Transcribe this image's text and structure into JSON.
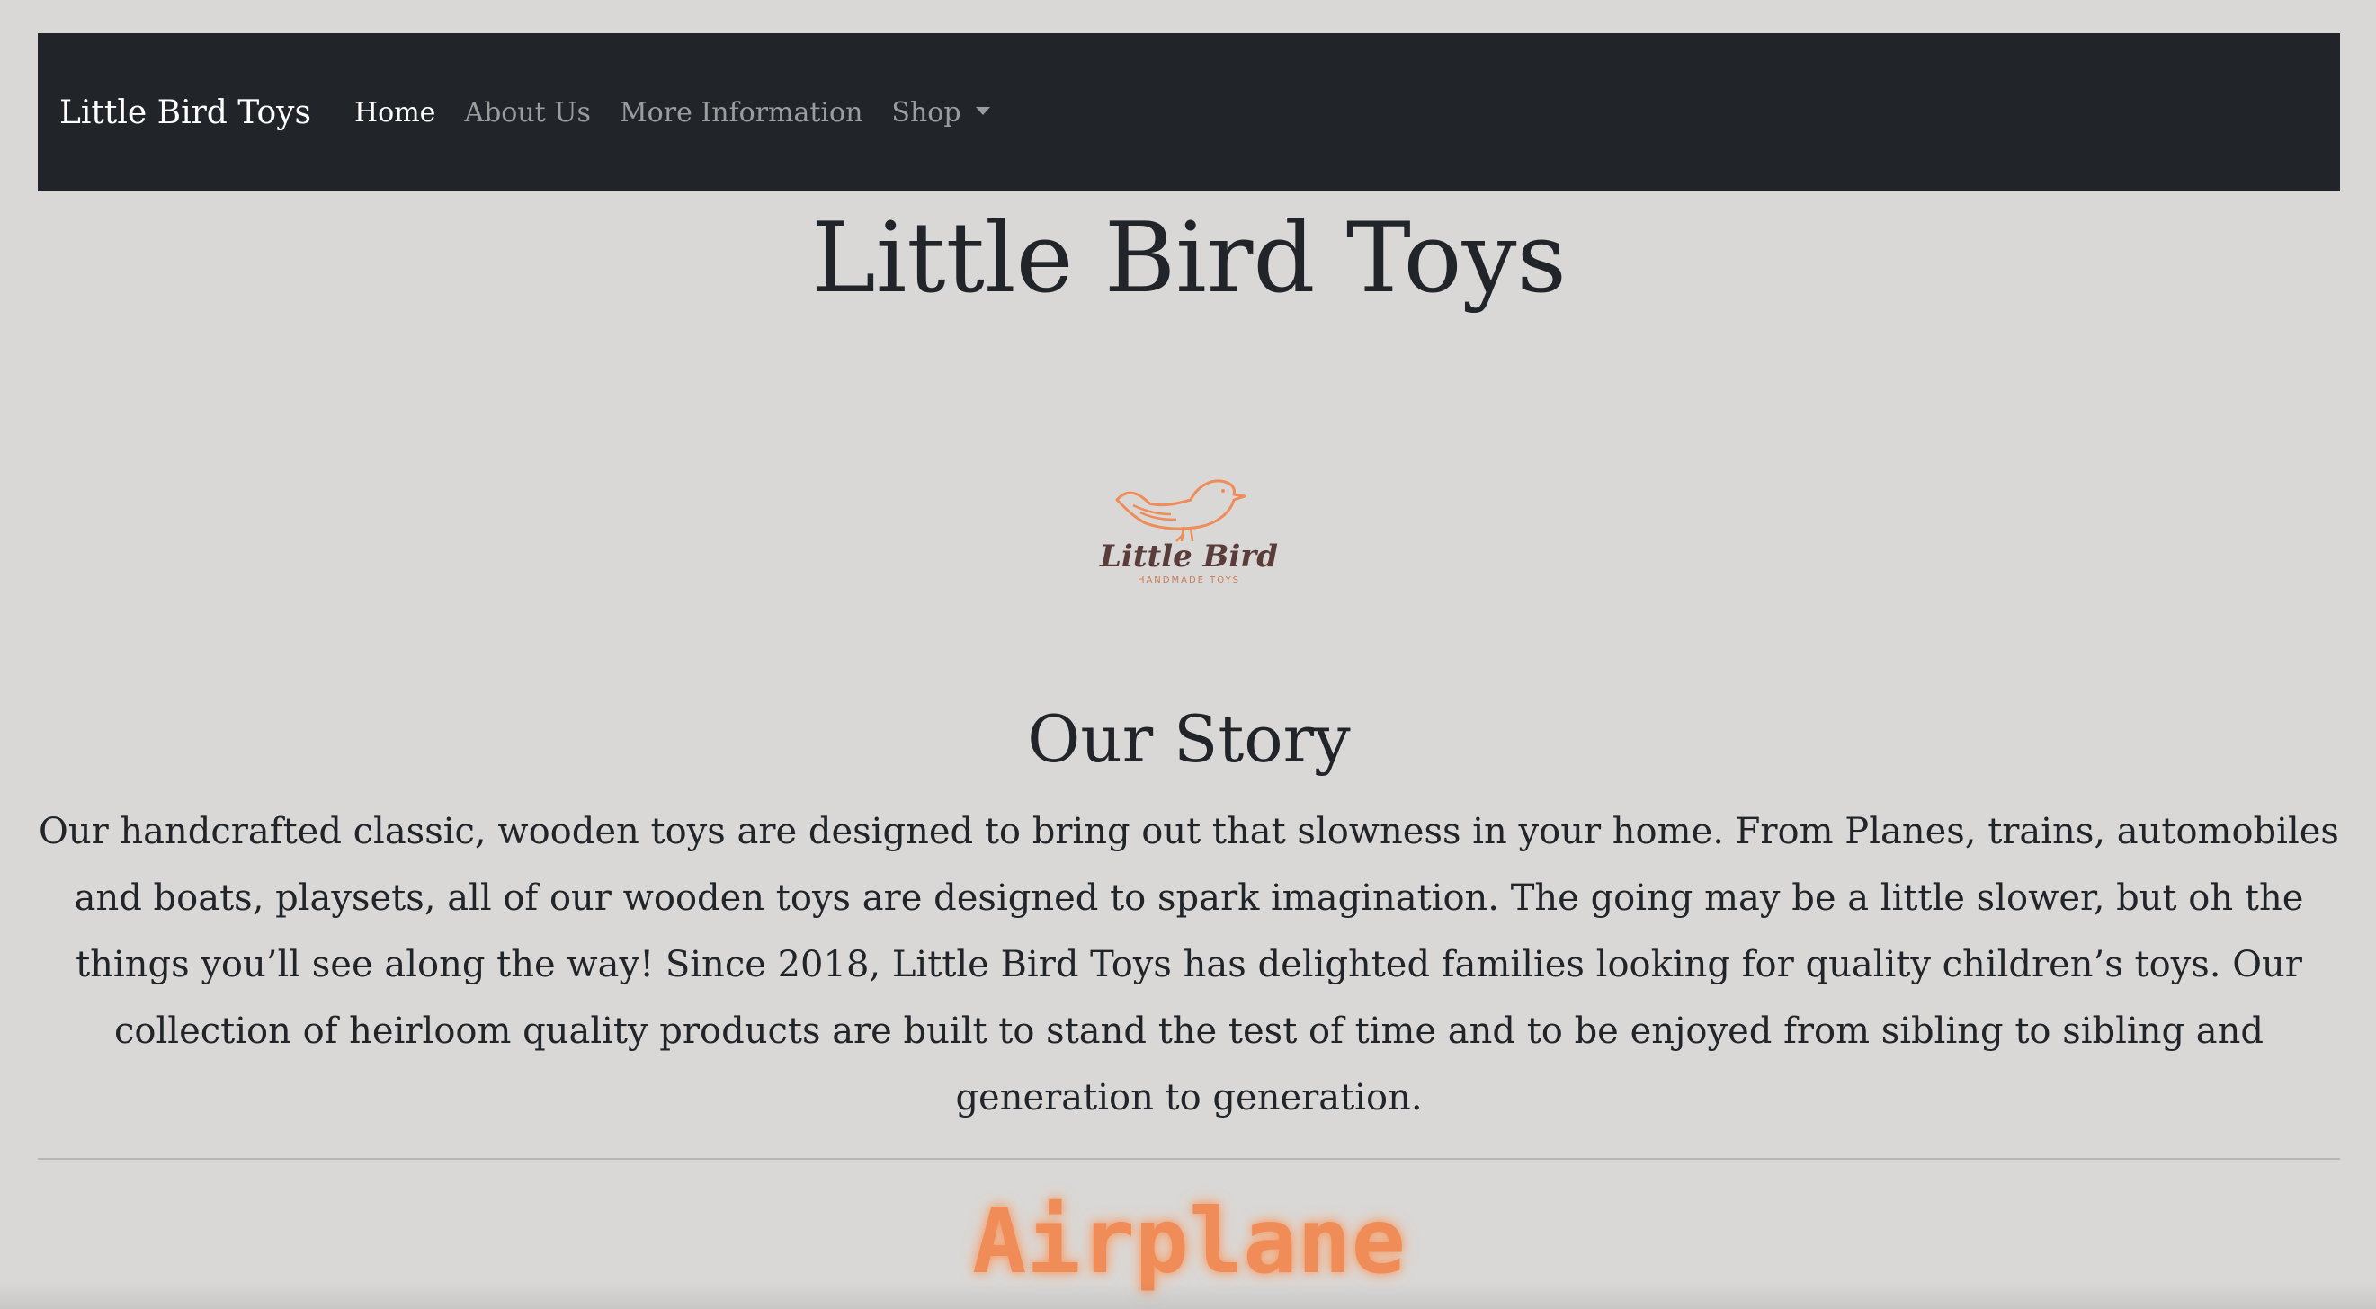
{
  "navbar": {
    "brand": "Little Bird Toys",
    "links": [
      {
        "label": "Home",
        "active": true
      },
      {
        "label": "About Us",
        "active": false
      },
      {
        "label": "More Information",
        "active": false
      },
      {
        "label": "Shop",
        "active": false,
        "dropdown": true
      }
    ]
  },
  "header": {
    "title": "Little Bird Toys"
  },
  "logo": {
    "icon": "little-bird-logo",
    "text": "Little Bird",
    "subtext": "HANDMADE TOYS"
  },
  "story": {
    "title": "Our Story",
    "text": "Our handcrafted classic, wooden toys are designed to bring out that slowness in your home. From Planes, trains, automobiles and boats, playsets, all of our wooden toys are designed to spark imagination. The going may be a little slower, but oh the things you’ll see along the way! Since 2018, Little Bird Toys has delighted families looking for quality children’s toys. Our collection of heirloom quality products are built to stand the test of time and to be enjoyed from sibling to sibling and generation to generation."
  },
  "product": {
    "title": "Airplane"
  },
  "colors": {
    "navbar": "#212529",
    "background": "#d9d8d7",
    "accent": "#ef8c57",
    "text": "#212529"
  }
}
